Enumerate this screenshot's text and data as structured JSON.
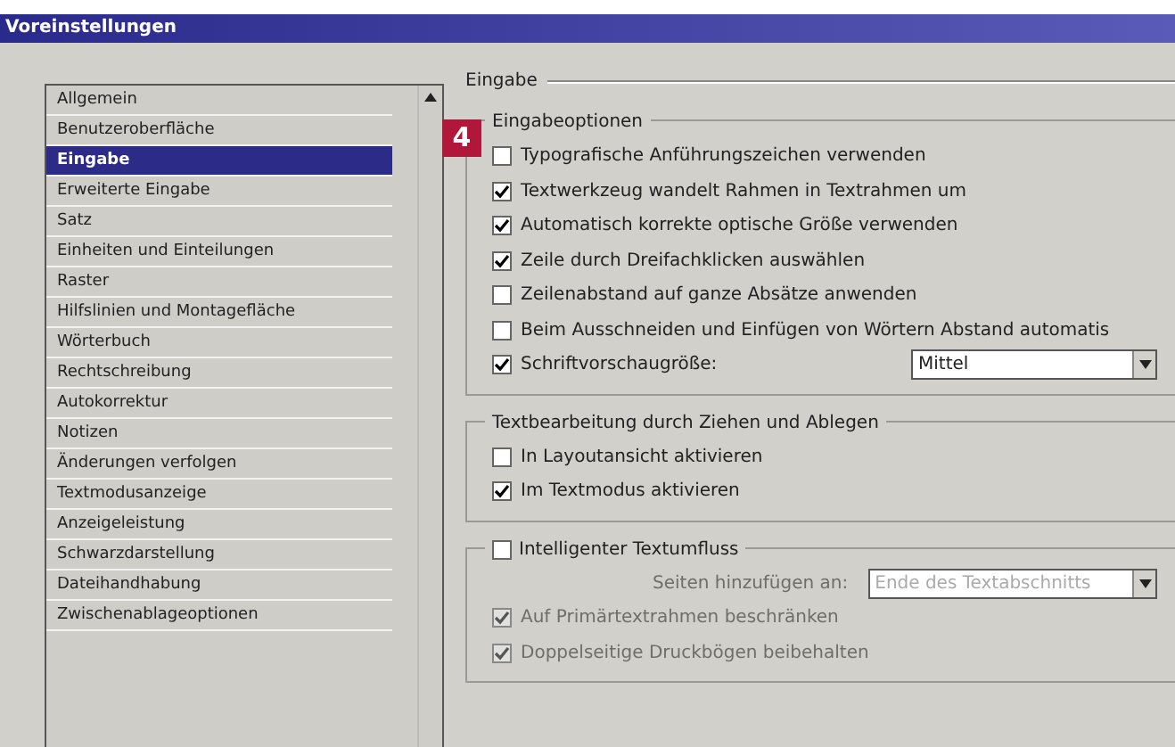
{
  "window": {
    "title": "Voreinstellungen"
  },
  "sidebar": {
    "items": [
      {
        "label": "Allgemein",
        "selected": false
      },
      {
        "label": "Benutzeroberfläche",
        "selected": false
      },
      {
        "label": "Eingabe",
        "selected": true
      },
      {
        "label": "Erweiterte Eingabe",
        "selected": false
      },
      {
        "label": "Satz",
        "selected": false
      },
      {
        "label": "Einheiten und Einteilungen",
        "selected": false
      },
      {
        "label": "Raster",
        "selected": false
      },
      {
        "label": "Hilfslinien und Montagefläche",
        "selected": false
      },
      {
        "label": "Wörterbuch",
        "selected": false
      },
      {
        "label": "Rechtschreibung",
        "selected": false
      },
      {
        "label": "Autokorrektur",
        "selected": false
      },
      {
        "label": "Notizen",
        "selected": false
      },
      {
        "label": "Änderungen verfolgen",
        "selected": false
      },
      {
        "label": "Textmodusanzeige",
        "selected": false
      },
      {
        "label": "Anzeigeleistung",
        "selected": false
      },
      {
        "label": "Schwarzdarstellung",
        "selected": false
      },
      {
        "label": "Dateihandhabung",
        "selected": false
      },
      {
        "label": "Zwischenablageoptionen",
        "selected": false
      }
    ]
  },
  "panel": {
    "title": "Eingabe",
    "callout": "4",
    "groups": [
      {
        "title": "Eingabeoptionen",
        "options": [
          {
            "label": "Typografische Anführungszeichen verwenden",
            "checked": false,
            "disabled": false
          },
          {
            "label": "Textwerkzeug wandelt Rahmen in Textrahmen um",
            "checked": true,
            "disabled": false
          },
          {
            "label": "Automatisch korrekte optische Größe verwenden",
            "checked": true,
            "disabled": false
          },
          {
            "label": "Zeile durch Dreifachklicken auswählen",
            "checked": true,
            "disabled": false
          },
          {
            "label": "Zeilenabstand auf ganze Absätze anwenden",
            "checked": false,
            "disabled": false
          },
          {
            "label": "Beim Ausschneiden und Einfügen von Wörtern Abstand automatis",
            "checked": false,
            "disabled": false
          },
          {
            "label": "Schriftvorschaugröße:",
            "checked": true,
            "disabled": false,
            "select": "Mittel"
          }
        ]
      },
      {
        "title": "Textbearbeitung durch Ziehen und Ablegen",
        "options": [
          {
            "label": "In Layoutansicht aktivieren",
            "checked": false,
            "disabled": false
          },
          {
            "label": "Im Textmodus aktivieren",
            "checked": true,
            "disabled": false
          }
        ]
      },
      {
        "title": "Intelligenter Textumfluss",
        "title_checked": false,
        "field_label": "Seiten hinzufügen an:",
        "field_value": "Ende des Textabschnitts",
        "options": [
          {
            "label": "Auf Primärtextrahmen beschränken",
            "checked": true,
            "disabled": true
          },
          {
            "label": "Doppelseitige Druckbögen beibehalten",
            "checked": true,
            "disabled": true
          }
        ]
      }
    ]
  }
}
